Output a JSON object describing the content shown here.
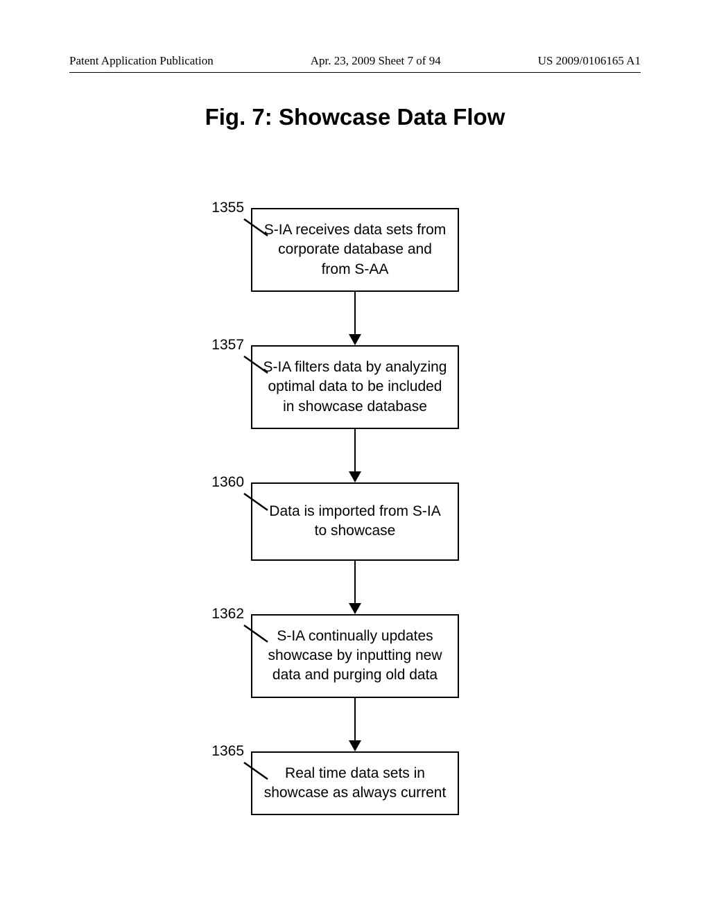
{
  "header": {
    "left": "Patent Application Publication",
    "center": "Apr. 23, 2009  Sheet 7 of 94",
    "right": "US 2009/0106165 A1"
  },
  "figure_title": "Fig. 7: Showcase Data Flow",
  "steps": [
    {
      "ref": "1355",
      "text": "S-IA receives data sets from corporate database and from S-AA"
    },
    {
      "ref": "1357",
      "text": "S-IA filters data by analyzing optimal data to be included in showcase database"
    },
    {
      "ref": "1360",
      "text": "Data is imported from S-IA to showcase"
    },
    {
      "ref": "1362",
      "text": "S-IA continually updates showcase by inputting new data and purging old data"
    },
    {
      "ref": "1365",
      "text": "Real time data sets in showcase as always current"
    }
  ]
}
